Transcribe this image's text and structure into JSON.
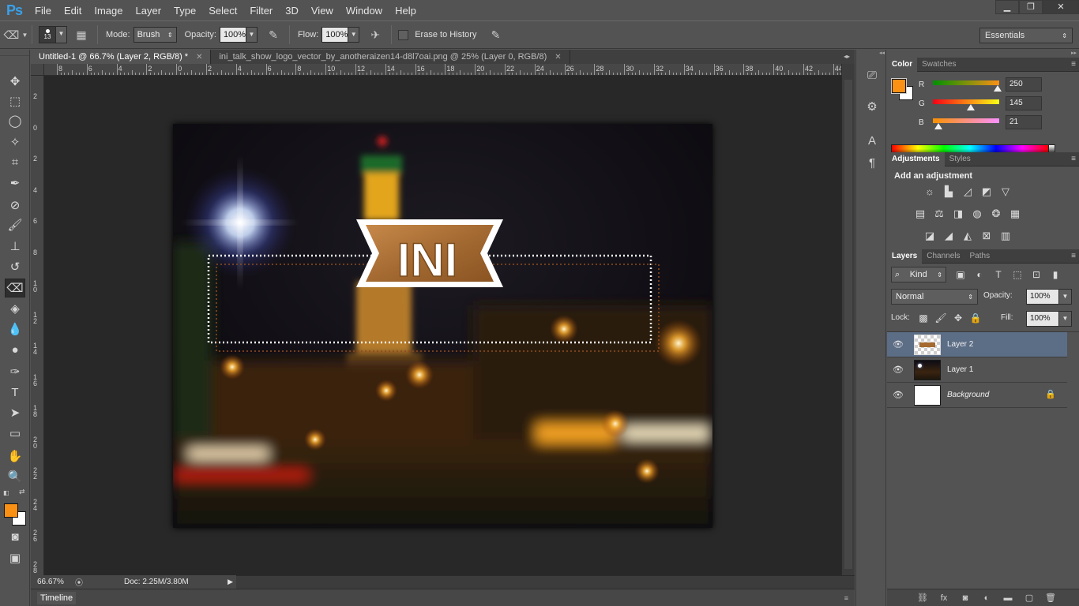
{
  "app": {
    "logo": "Ps",
    "colors": {
      "foreground": "#fa9115",
      "background": "#ffffff",
      "selection": "#5c6d86"
    }
  },
  "menu": [
    "File",
    "Edit",
    "Image",
    "Layer",
    "Type",
    "Select",
    "Filter",
    "3D",
    "View",
    "Window",
    "Help"
  ],
  "window_controls": {
    "minimize": "minimize-icon",
    "restore": "restore-icon",
    "close": "close-icon"
  },
  "options": {
    "brush_size": "13",
    "mode_label": "Mode:",
    "mode_value": "Brush",
    "opacity_label": "Opacity:",
    "opacity_value": "100%",
    "flow_label": "Flow:",
    "flow_value": "100%",
    "erase_history_label": "Erase to History",
    "workspace": "Essentials"
  },
  "tabs": [
    {
      "label": "Untitled-1 @ 66.7% (Layer 2, RGB/8) *",
      "active": true
    },
    {
      "label": "ini_talk_show_logo_vector_by_anotheraizen14-d8l7oai.png @ 25% (Layer 0, RGB/8)",
      "active": false
    }
  ],
  "ruler_h": [
    "8",
    "6",
    "4",
    "2",
    "0",
    "2",
    "4",
    "6",
    "8",
    "10",
    "12",
    "14",
    "16",
    "18",
    "20",
    "22",
    "24",
    "26",
    "28",
    "30",
    "32",
    "34",
    "36",
    "38",
    "40",
    "42",
    "44"
  ],
  "ruler_v": [
    "2",
    "0",
    "2",
    "4",
    "6",
    "8",
    "10",
    "12",
    "14",
    "16",
    "18",
    "20",
    "22",
    "24",
    "26",
    "28"
  ],
  "canvas": {
    "logo_text": "INI"
  },
  "status": {
    "zoom": "66.67%",
    "doc": "Doc: 2.25M/3.80M"
  },
  "timeline": {
    "label": "Timeline"
  },
  "color_panel": {
    "tabs": [
      "Color",
      "Swatches"
    ],
    "channels": [
      {
        "name": "R",
        "value": "250",
        "fraction": 0.98
      },
      {
        "name": "G",
        "value": "145",
        "fraction": 0.57
      },
      {
        "name": "B",
        "value": "21",
        "fraction": 0.08
      }
    ]
  },
  "adjustments_panel": {
    "tabs": [
      "Adjustments",
      "Styles"
    ],
    "title": "Add an adjustment"
  },
  "layers_panel": {
    "tabs": [
      "Layers",
      "Channels",
      "Paths"
    ],
    "kind": "Kind",
    "blend_mode": "Normal",
    "opacity_label": "Opacity:",
    "opacity_value": "100%",
    "lock_label": "Lock:",
    "fill_label": "Fill:",
    "fill_value": "100%",
    "layers": [
      {
        "name": "Layer 2",
        "selected": true
      },
      {
        "name": "Layer 1",
        "selected": false
      },
      {
        "name": "Background",
        "selected": false,
        "locked": true
      }
    ]
  }
}
